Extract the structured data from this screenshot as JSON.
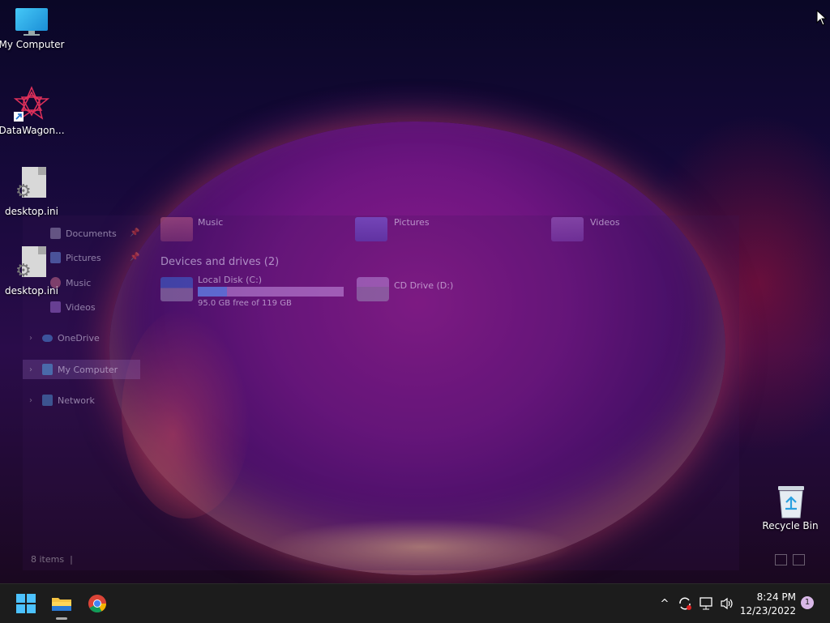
{
  "desktop": {
    "icons": [
      {
        "label": "My Computer"
      },
      {
        "label": "DataWagon..."
      },
      {
        "label": "desktop.ini"
      },
      {
        "label": "desktop.ini"
      },
      {
        "label": "Recycle Bin"
      }
    ]
  },
  "explorer": {
    "nav": {
      "items": [
        {
          "label": "Documents",
          "icon": "documents-icon"
        },
        {
          "label": "Pictures",
          "icon": "pictures-icon"
        },
        {
          "label": "Music",
          "icon": "music-icon"
        },
        {
          "label": "Videos",
          "icon": "videos-icon"
        },
        {
          "label": "OneDrive",
          "icon": "onedrive-icon"
        },
        {
          "label": "My Computer",
          "icon": "computer-icon"
        },
        {
          "label": "Network",
          "icon": "network-icon"
        }
      ]
    },
    "folders": [
      {
        "label": "Music"
      },
      {
        "label": "Pictures"
      },
      {
        "label": "Videos"
      }
    ],
    "devices_title": "Devices and drives (2)",
    "drives": [
      {
        "label": "Local Disk (C:)",
        "free_text": "95.0 GB free of 119 GB",
        "used_fraction": 0.2
      },
      {
        "label": "CD Drive (D:)"
      }
    ],
    "status_text": "8 items"
  },
  "taskbar": {
    "clock_time": "8:24 PM",
    "clock_date": "12/23/2022",
    "notification_count": "1"
  }
}
